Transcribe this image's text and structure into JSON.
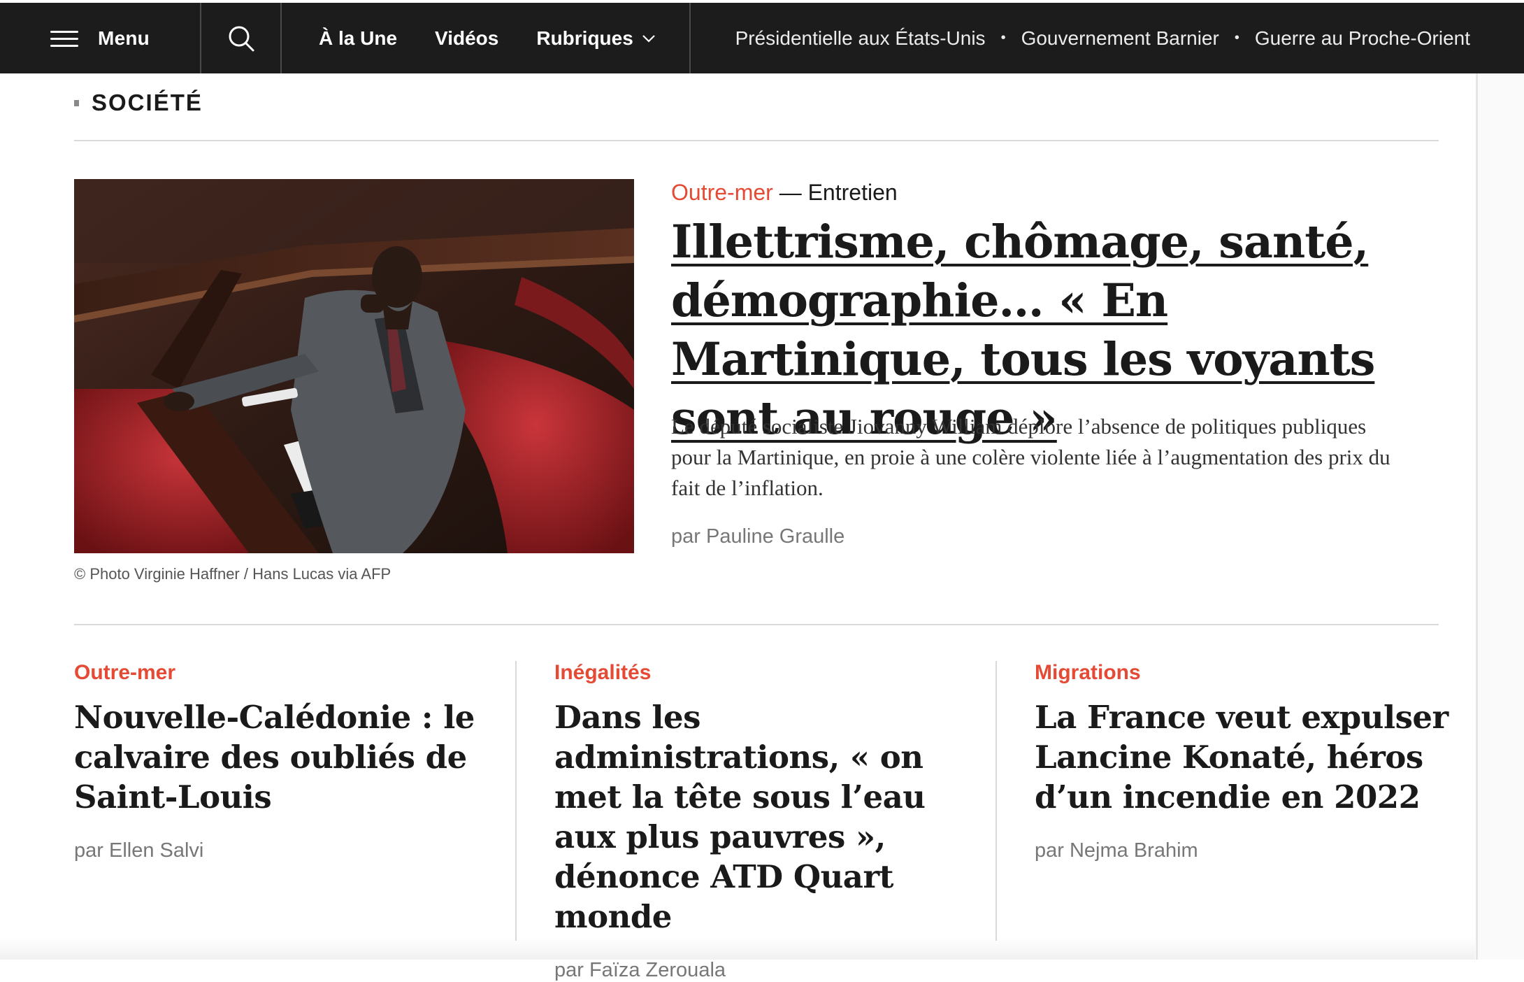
{
  "nav": {
    "menu_label": "Menu",
    "links": [
      "À la Une",
      "Vidéos",
      "Rubriques"
    ],
    "trending": [
      "Présidentielle aux États-Unis",
      "Gouvernement Barnier",
      "Guerre au Proche-Orient"
    ]
  },
  "section": {
    "title": "SOCIÉTÉ"
  },
  "featured": {
    "kicker": "Outre-mer",
    "type": "— Entretien",
    "headline": "Illettrisme, chômage, santé, démographie… « En Martinique, tous les voyants sont au rouge »",
    "standfirst": "Le député socialiste Jiovanny William déplore l’absence de politiques publiques pour la Martinique, en proie à une colère violente liée à l’augmentation des prix du fait de l’inflation.",
    "byline": "par Pauline Graulle",
    "photo_credit": "© Photo Virginie Haffner / Hans Lucas via AFP"
  },
  "cards": [
    {
      "kicker": "Outre-mer",
      "title": "Nouvelle-Calédonie : le calvaire des oubliés de Saint-Louis",
      "byline": "par Ellen Salvi"
    },
    {
      "kicker": "Inégalités",
      "title": "Dans les administrations, « on met la tête sous l’eau aux plus pauvres », dénonce ATD Quart monde",
      "byline": "par Faïza Zerouala"
    },
    {
      "kicker": "Migrations",
      "title": "La France veut expulser Lancine Konaté, héros d’un incendie en 2022",
      "byline": "par Nejma Brahim"
    }
  ],
  "colors": {
    "accent": "#e44a34",
    "topbar": "#1c1c1c"
  }
}
